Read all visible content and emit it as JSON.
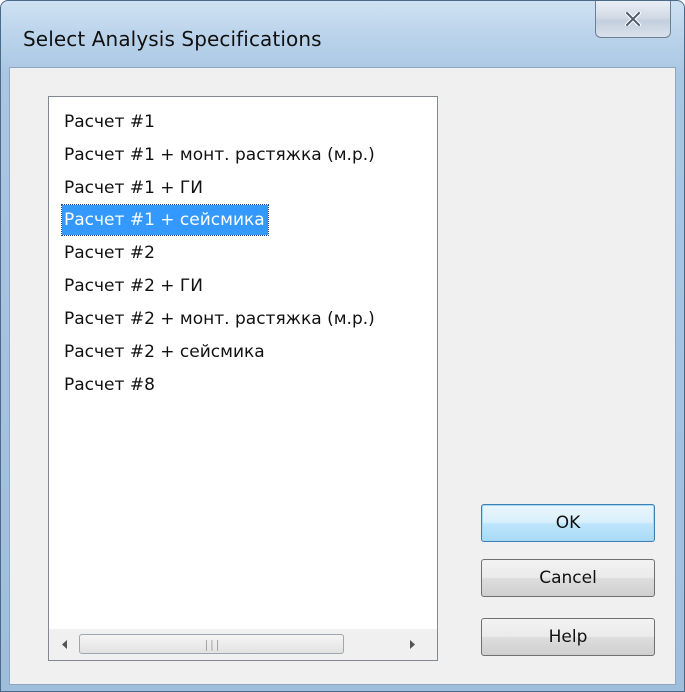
{
  "window": {
    "title": "Select Analysis Specifications"
  },
  "list": {
    "items": [
      "Расчет #1",
      "Расчет #1 + монт. растяжка (м.р.)",
      "Расчет #1 + ГИ",
      "Расчет #1 + сейсмика",
      "Расчет #2",
      "Расчет #2 + ГИ",
      "Расчет #2 + монт. растяжка (м.р.)",
      "Расчет #2 + сейсмика",
      "Расчет #8"
    ],
    "selected_index": 3
  },
  "buttons": {
    "ok": "OK",
    "cancel": "Cancel",
    "help": "Help"
  },
  "icons": {
    "close": "close-icon",
    "scroll_left": "chevron-left-icon",
    "scroll_right": "chevron-right-icon",
    "scroll_grip": "grip-icon"
  },
  "colors": {
    "selection": "#3399ff",
    "selection_text": "#ffffff"
  }
}
